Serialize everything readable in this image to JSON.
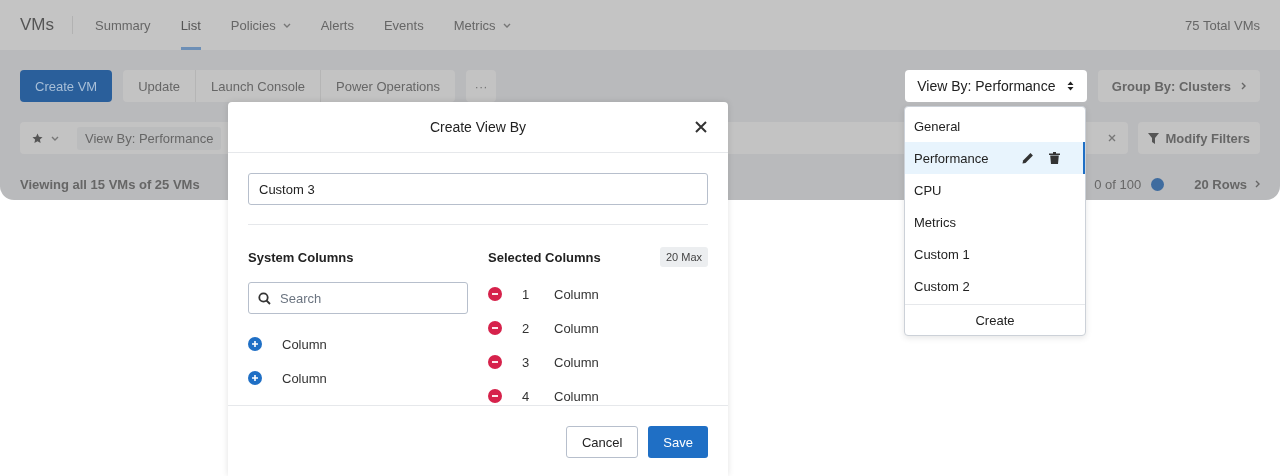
{
  "nav": {
    "title": "VMs",
    "tabs": [
      {
        "label": "Summary",
        "selected": false,
        "dropdown": false
      },
      {
        "label": "List",
        "selected": true,
        "dropdown": false
      },
      {
        "label": "Policies",
        "selected": false,
        "dropdown": true
      },
      {
        "label": "Alerts",
        "selected": false,
        "dropdown": false
      },
      {
        "label": "Events",
        "selected": false,
        "dropdown": false
      },
      {
        "label": "Metrics",
        "selected": false,
        "dropdown": true
      }
    ],
    "total": "75 Total VMs"
  },
  "toolbar": {
    "primary": "Create VM",
    "actions": [
      "Update",
      "Launch Console",
      "Power Operations"
    ],
    "more": "···",
    "view_by": "View By: Performance",
    "group_by": "Group By: Clusters"
  },
  "filter_bar": {
    "chip": "View By: Performance",
    "modify": "Modify Filters"
  },
  "status": {
    "summary": "Viewing all 15 VMs of 25 VMs",
    "pagination": "0 of 100",
    "rows": "20 Rows"
  },
  "dialog": {
    "title": "Create View By",
    "name_value": "Custom 3",
    "system_columns": {
      "heading": "System Columns",
      "search_placeholder": "Search",
      "items": [
        "Column",
        "Column"
      ]
    },
    "selected_columns": {
      "heading": "Selected Columns",
      "limit": "20 Max",
      "items": [
        {
          "index": "1",
          "label": "Column"
        },
        {
          "index": "2",
          "label": "Column"
        },
        {
          "index": "3",
          "label": "Column"
        },
        {
          "index": "4",
          "label": "Column"
        }
      ]
    },
    "buttons": {
      "cancel": "Cancel",
      "save": "Save"
    }
  },
  "view_menu": {
    "items": [
      {
        "label": "General",
        "selected": false
      },
      {
        "label": "Performance",
        "selected": true
      },
      {
        "label": "CPU",
        "selected": false
      },
      {
        "label": "Metrics",
        "selected": false
      },
      {
        "label": "Custom 1",
        "selected": false
      },
      {
        "label": "Custom 2",
        "selected": false
      }
    ],
    "create": "Create"
  }
}
